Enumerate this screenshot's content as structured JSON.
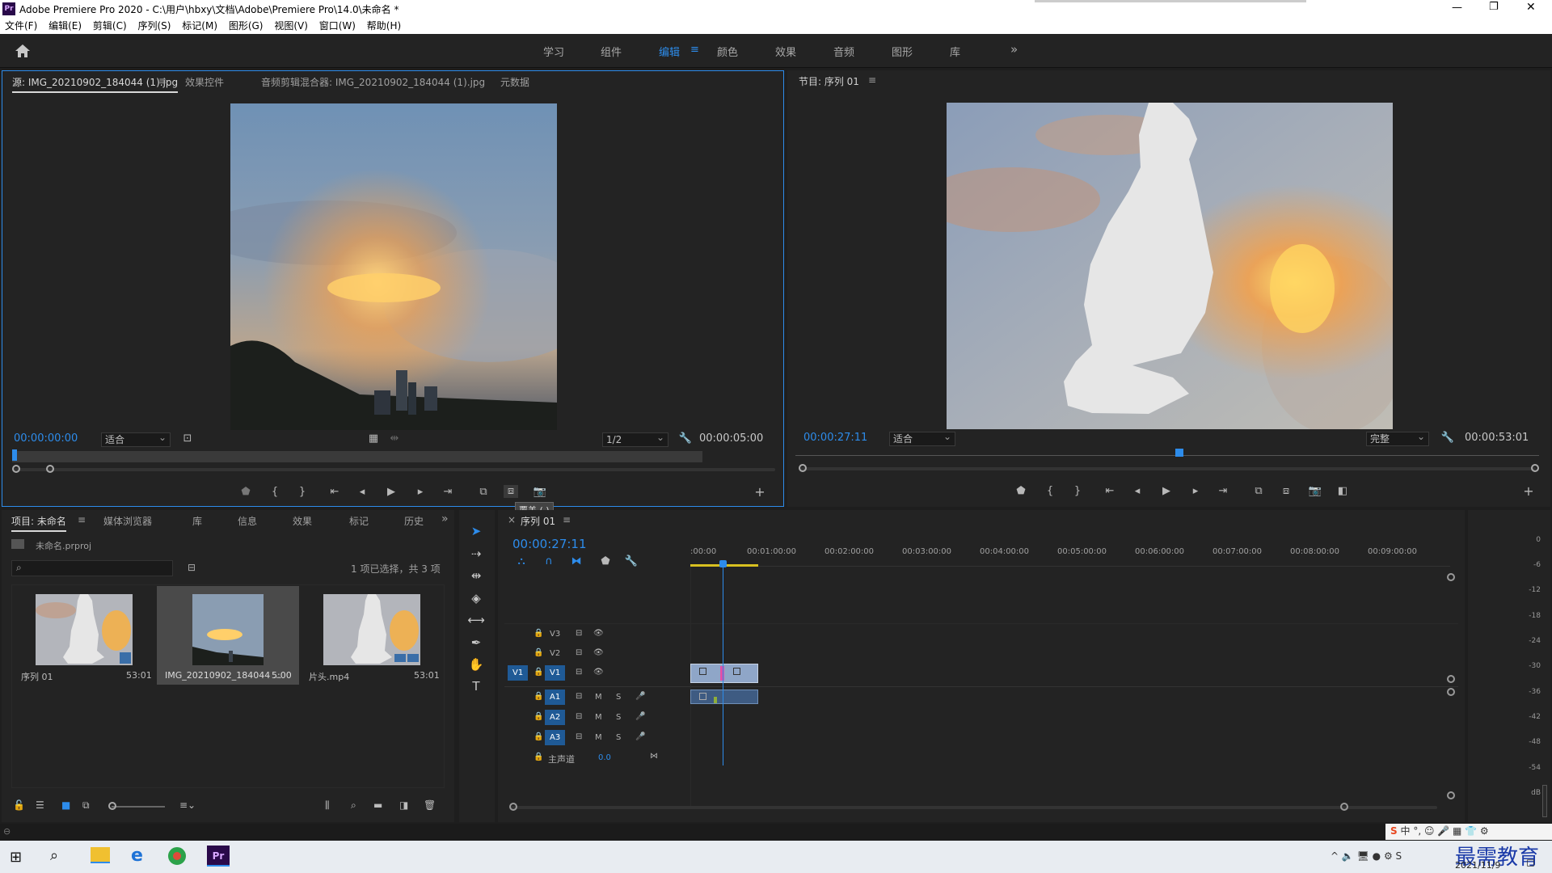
{
  "titlebar": {
    "app_icon": "Pr",
    "title": "Adobe Premiere Pro 2020 - C:\\用户\\hbxy\\文档\\Adobe\\Premiere Pro\\14.0\\未命名 *",
    "min": "—",
    "max": "❐",
    "close": "✕"
  },
  "menu": [
    "文件(F)",
    "编辑(E)",
    "剪辑(C)",
    "序列(S)",
    "标记(M)",
    "图形(G)",
    "视图(V)",
    "窗口(W)",
    "帮助(H)"
  ],
  "workspaces": [
    "学习",
    "组件",
    "编辑",
    "颜色",
    "效果",
    "音频",
    "图形",
    "库"
  ],
  "workspace_active": "编辑",
  "workspace_more": "»",
  "source": {
    "tabs": [
      "源: IMG_20210902_184044 (1).jpg",
      "效果控件",
      "音频剪辑混合器: IMG_20210902_184044 (1).jpg",
      "元数据"
    ],
    "timecode": "00:00:00:00",
    "fit": "适合",
    "resolution": "1/2",
    "duration": "00:00:05:00",
    "tooltip": "覆盖 (.)"
  },
  "program": {
    "tab": "节目: 序列 01",
    "timecode": "00:00:27:11",
    "fit": "适合",
    "resolution": "完整",
    "duration": "00:00:53:01"
  },
  "project": {
    "tabs": [
      "项目: 未命名",
      "媒体浏览器",
      "库",
      "信息",
      "效果",
      "标记",
      "历史"
    ],
    "file": "未命名.prproj",
    "selection": "1 项已选择，共 3 项",
    "items": [
      {
        "name": "序列 01",
        "duration": "53:01"
      },
      {
        "name": "IMG_20210902_184044 ...",
        "duration": "5:00"
      },
      {
        "name": "片头.mp4",
        "duration": "53:01"
      }
    ]
  },
  "timeline": {
    "tab": "序列 01",
    "timecode": "00:00:27:11",
    "ruler": [
      ":00:00",
      "00:01:00:00",
      "00:02:00:00",
      "00:03:00:00",
      "00:04:00:00",
      "00:05:00:00",
      "00:06:00:00",
      "00:07:00:00",
      "00:08:00:00",
      "00:09:00:00"
    ],
    "video_tracks": [
      "V3",
      "V2",
      "V1"
    ],
    "audio_tracks": [
      "A1",
      "A2",
      "A3"
    ],
    "master_label": "主声道",
    "master_value": "0.0",
    "target_v": "V1",
    "mute": "M",
    "solo": "S"
  },
  "meter": {
    "labels": [
      "0",
      "-6",
      "-12",
      "-18",
      "-24",
      "-30",
      "-36",
      "-42",
      "-48",
      "-54",
      "dB"
    ],
    "footer": "S S"
  },
  "taskbar": {
    "date": "2021/11/9",
    "watermark": "最需教育",
    "ime": "中"
  }
}
